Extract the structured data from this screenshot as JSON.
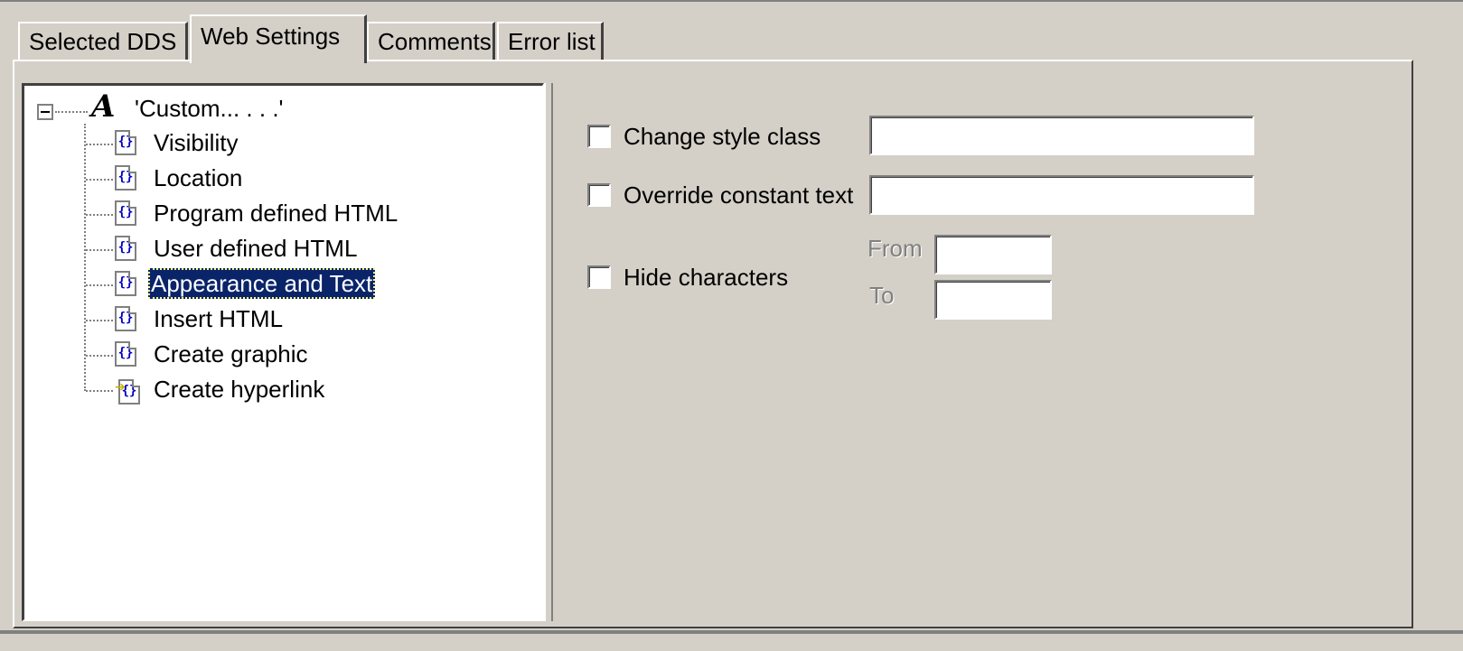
{
  "tabs": [
    {
      "label": "Selected DDS",
      "active": false
    },
    {
      "label": "Web Settings",
      "active": true
    },
    {
      "label": "Comments",
      "active": false
    },
    {
      "label": "Error list",
      "active": false
    }
  ],
  "tree": {
    "root": {
      "label": "'Custom... . . .'",
      "icon": "font-a-icon",
      "expanded": true
    },
    "items": [
      {
        "label": "Visibility",
        "icon": "html-file-icon"
      },
      {
        "label": "Location",
        "icon": "html-file-icon"
      },
      {
        "label": "Program defined HTML",
        "icon": "html-file-icon"
      },
      {
        "label": "User defined HTML",
        "icon": "html-file-icon"
      },
      {
        "label": "Appearance and Text",
        "icon": "html-file-icon",
        "selected": true
      },
      {
        "label": "Insert HTML",
        "icon": "html-file-icon"
      },
      {
        "label": "Create graphic",
        "icon": "html-file-icon"
      },
      {
        "label": "Create hyperlink",
        "icon": "hyperlink-file-icon"
      }
    ]
  },
  "form": {
    "change_style_class": {
      "label": "Change style class",
      "checked": false,
      "value": ""
    },
    "override_constant_text": {
      "label": "Override constant text",
      "checked": false,
      "value": ""
    },
    "hide_characters": {
      "label": "Hide characters",
      "checked": false,
      "from_label": "From",
      "from_value": "",
      "to_label": "To",
      "to_value": ""
    }
  },
  "colors": {
    "face": "#d4d0c8",
    "selection": "#0a246a",
    "disabled_text": "#808080"
  }
}
